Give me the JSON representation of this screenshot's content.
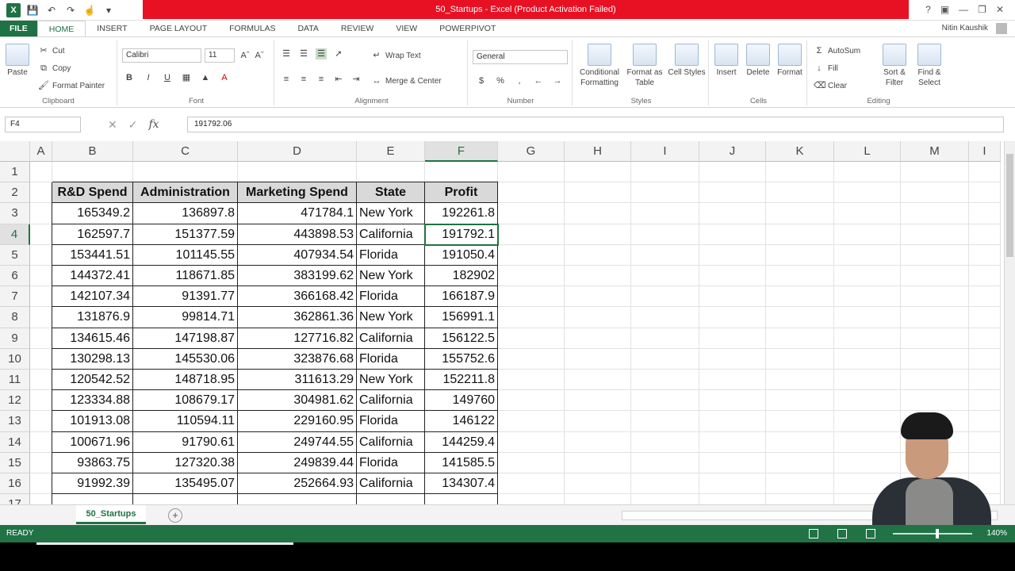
{
  "window": {
    "title": "50_Startups - Excel (Product Activation Failed)",
    "user": "Nitin Kaushik"
  },
  "ribbon_tabs": [
    "FILE",
    "HOME",
    "INSERT",
    "PAGE LAYOUT",
    "FORMULAS",
    "DATA",
    "REVIEW",
    "VIEW",
    "POWERPIVOT"
  ],
  "ribbon": {
    "clipboard": {
      "paste": "Paste",
      "cut": "Cut",
      "copy": "Copy",
      "format_painter": "Format Painter",
      "label": "Clipboard"
    },
    "font": {
      "name": "Calibri",
      "size": "11",
      "label": "Font"
    },
    "alignment": {
      "wrap_text": "Wrap Text",
      "merge_center": "Merge & Center",
      "label": "Alignment"
    },
    "number": {
      "format": "General",
      "label": "Number"
    },
    "styles": {
      "conditional": "Conditional Formatting",
      "format_table": "Format as Table",
      "cell_styles": "Cell Styles",
      "label": "Styles"
    },
    "cells": {
      "insert": "Insert",
      "delete": "Delete",
      "format": "Format",
      "label": "Cells"
    },
    "editing": {
      "autosum": "AutoSum",
      "fill": "Fill",
      "clear": "Clear",
      "sort_filter": "Sort & Filter",
      "find_select": "Find & Select",
      "label": "Editing"
    }
  },
  "formula_bar": {
    "name_box": "F4",
    "value": "191792.06"
  },
  "columns": [
    "A",
    "B",
    "C",
    "D",
    "E",
    "F",
    "G",
    "H",
    "I",
    "J",
    "K",
    "L",
    "M",
    "I"
  ],
  "rows": [
    "1",
    "2",
    "3",
    "4",
    "5",
    "6",
    "7",
    "8",
    "9",
    "10",
    "11",
    "12",
    "13",
    "14",
    "15",
    "16",
    "17"
  ],
  "table": {
    "headers": [
      "R&D Spend",
      "Administration",
      "Marketing Spend",
      "State",
      "Profit"
    ],
    "rows": [
      [
        "165349.2",
        "136897.8",
        "471784.1",
        "New York",
        "192261.8"
      ],
      [
        "162597.7",
        "151377.59",
        "443898.53",
        "California",
        "191792.1"
      ],
      [
        "153441.51",
        "101145.55",
        "407934.54",
        "Florida",
        "191050.4"
      ],
      [
        "144372.41",
        "118671.85",
        "383199.62",
        "New York",
        "182902"
      ],
      [
        "142107.34",
        "91391.77",
        "366168.42",
        "Florida",
        "166187.9"
      ],
      [
        "131876.9",
        "99814.71",
        "362861.36",
        "New York",
        "156991.1"
      ],
      [
        "134615.46",
        "147198.87",
        "127716.82",
        "California",
        "156122.5"
      ],
      [
        "130298.13",
        "145530.06",
        "323876.68",
        "Florida",
        "155752.6"
      ],
      [
        "120542.52",
        "148718.95",
        "311613.29",
        "New York",
        "152211.8"
      ],
      [
        "123334.88",
        "108679.17",
        "304981.62",
        "California",
        "149760"
      ],
      [
        "101913.08",
        "110594.11",
        "229160.95",
        "Florida",
        "146122"
      ],
      [
        "100671.96",
        "91790.61",
        "249744.55",
        "California",
        "144259.4"
      ],
      [
        "93863.75",
        "127320.38",
        "249839.44",
        "Florida",
        "141585.5"
      ],
      [
        "91992.39",
        "135495.07",
        "252664.93",
        "California",
        "134307.4"
      ]
    ]
  },
  "sheet_tab": "50_Startups",
  "status": {
    "ready": "READY",
    "zoom": "140%"
  },
  "colors": {
    "excel_green": "#217346",
    "title_red": "#e81123"
  }
}
